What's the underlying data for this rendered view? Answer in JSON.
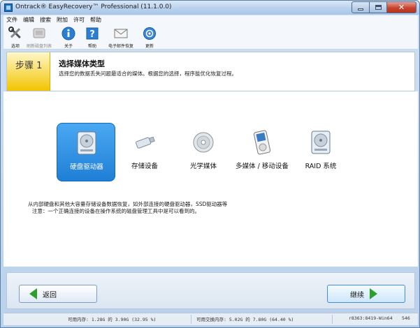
{
  "window": {
    "title": "Ontrack® EasyRecovery™ Professional (11.1.0.0)"
  },
  "menu": [
    "文件",
    "编辑",
    "搜索",
    "附加",
    "许可",
    "帮助"
  ],
  "toolbar": [
    {
      "label": "选项",
      "icon": "tools-icon",
      "enabled": true
    },
    {
      "label": "刷新磁盘列表",
      "icon": "refresh-disk-icon",
      "enabled": false
    },
    {
      "label": "关于",
      "icon": "info-icon",
      "enabled": true
    },
    {
      "label": "帮助",
      "icon": "help-icon",
      "enabled": true
    },
    {
      "label": "电子邮件恢复",
      "icon": "email-icon",
      "enabled": true
    },
    {
      "label": "更新",
      "icon": "update-icon",
      "enabled": true
    }
  ],
  "step": {
    "number": "步骤 1",
    "title": "选择媒体类型",
    "description": "选择您的数据丢失问题最适合的媒体。根据您的选择，程序能优化恢复过程。"
  },
  "media": [
    {
      "label": "硬盘驱动器",
      "icon": "hard-drive-icon",
      "selected": true
    },
    {
      "label": "存储设备",
      "icon": "usb-drive-icon",
      "selected": false
    },
    {
      "label": "光学媒体",
      "icon": "optical-disc-icon",
      "selected": false
    },
    {
      "label": "多媒体 / 移动设备",
      "icon": "ipod-icon",
      "selected": false
    },
    {
      "label": "RAID 系统",
      "icon": "raid-icon",
      "selected": false
    }
  ],
  "info": {
    "line1": "从内部硬盘和其他大容量存储设备数据恢复，如外部连接的硬盘驱动器，SSD驱动器等",
    "line2": "注意：一个正确连接的设备在操作系统的磁盘管理工具中是可以看到的。"
  },
  "nav": {
    "back_label": "返回",
    "next_label": "继续"
  },
  "status": {
    "memory": "可用内存: 1.28G 的 3.90G (32.95 %)",
    "swap": "可用交换内存: 5.02G 的 7.80G (64.40 %)",
    "build": "r8363:8419-Win64",
    "extra": "546"
  },
  "colors": {
    "selected_tile": "#1f7fd6",
    "step_badge": "#f2c400",
    "arrow": "#2ba12b"
  }
}
